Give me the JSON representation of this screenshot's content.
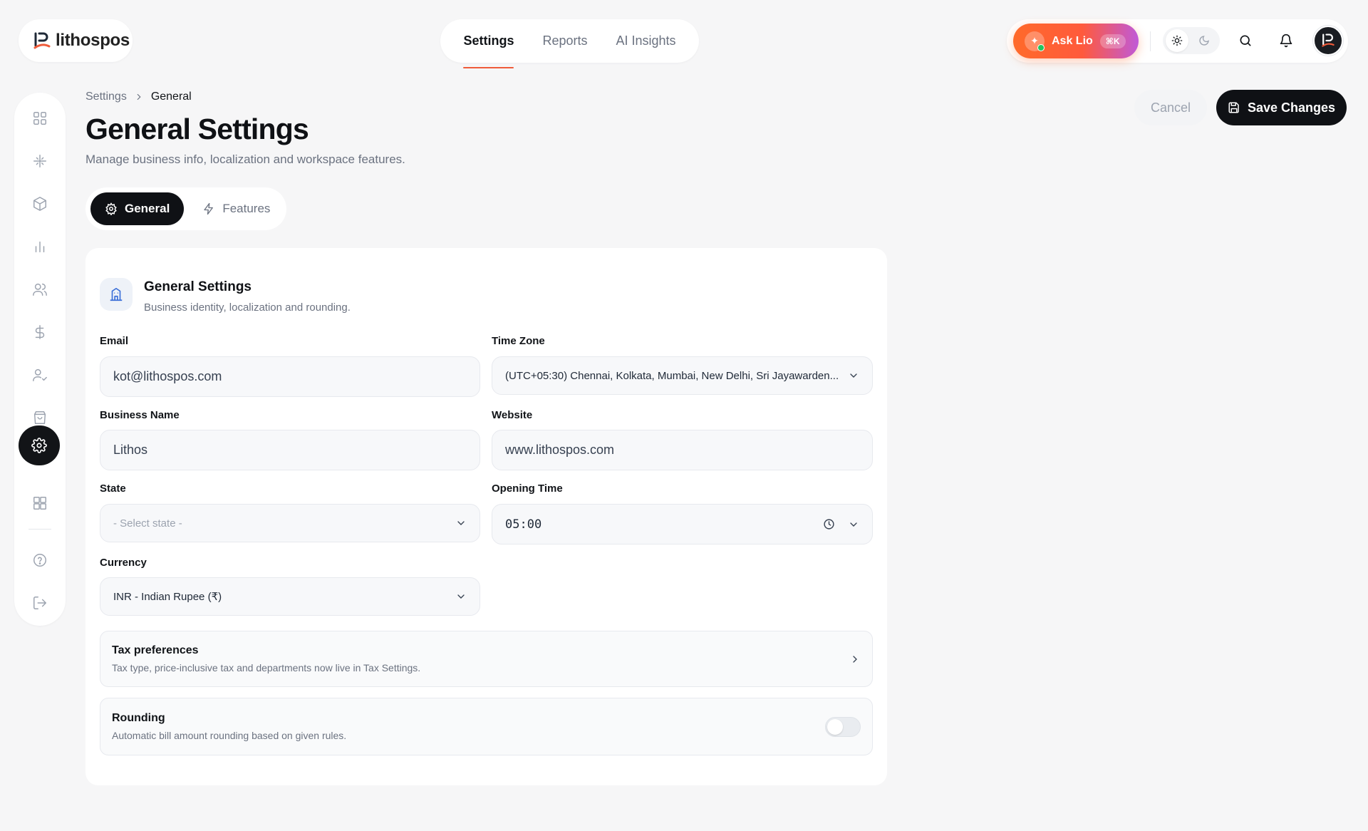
{
  "brand": {
    "name": "lithospos"
  },
  "topnav": {
    "tabs": [
      {
        "label": "Settings",
        "active": true
      },
      {
        "label": "Reports",
        "active": false
      },
      {
        "label": "AI Insights",
        "active": false
      }
    ]
  },
  "header_actions": {
    "ask_label": "Ask Lio",
    "ask_shortcut": "⌘K",
    "theme": "light"
  },
  "sidebar": {
    "items": [
      {
        "icon": "grid-icon",
        "active": false
      },
      {
        "icon": "sparkle-icon",
        "active": false
      },
      {
        "icon": "box-icon",
        "active": false
      },
      {
        "icon": "bar-chart-icon",
        "active": false
      },
      {
        "icon": "users-icon",
        "active": false
      },
      {
        "icon": "dollar-icon",
        "active": false
      },
      {
        "icon": "user-check-icon",
        "active": false
      },
      {
        "icon": "shopping-bag-icon",
        "active": false
      },
      {
        "icon": "settings-icon",
        "active": true
      },
      {
        "icon": "apps-icon",
        "active": false
      }
    ],
    "footer": [
      {
        "icon": "help-icon"
      },
      {
        "icon": "logout-icon"
      }
    ]
  },
  "breadcrumb": {
    "parent": "Settings",
    "current": "General"
  },
  "page": {
    "title": "General Settings",
    "subtitle": "Manage business info, localization and workspace features.",
    "cancel_label": "Cancel",
    "save_label": "Save Changes"
  },
  "tabs": {
    "general": "General",
    "features": "Features",
    "active": "general"
  },
  "card": {
    "title": "General Settings",
    "subtitle": "Business identity, localization and rounding."
  },
  "form": {
    "email": {
      "label": "Email",
      "value": "kot@lithospos.com"
    },
    "timezone": {
      "label": "Time Zone",
      "value": "(UTC+05:30) Chennai, Kolkata, Mumbai, New Delhi, Sri Jayawarden..."
    },
    "business_name": {
      "label": "Business Name",
      "value": "Lithos"
    },
    "website": {
      "label": "Website",
      "value": "www.lithospos.com"
    },
    "state": {
      "label": "State",
      "placeholder": "- Select state -"
    },
    "opening_time": {
      "label": "Opening Time",
      "value": "05:00"
    },
    "currency": {
      "label": "Currency",
      "value": "INR - Indian Rupee (₹)"
    }
  },
  "tax_preferences": {
    "title": "Tax preferences",
    "subtitle": "Tax type, price-inclusive tax and departments now live in Tax Settings."
  },
  "rounding": {
    "title": "Rounding",
    "subtitle": "Automatic bill amount rounding based on given rules.",
    "enabled": false
  },
  "colors": {
    "accent": "#ef5b3a",
    "dark": "#0f1115",
    "ask_gradient_start": "#ff6a2a",
    "ask_gradient_end": "#c05ad8"
  }
}
